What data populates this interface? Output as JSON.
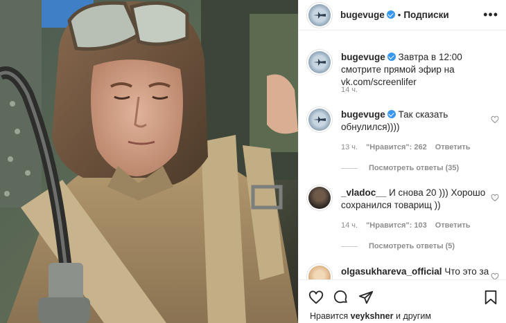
{
  "post": {
    "author": "bugevuge",
    "header_separator": "•",
    "follow_status": "Подписки",
    "more_icon": "more-dots-icon"
  },
  "comments": [
    {
      "user": "bugevuge",
      "text": "Завтра в 12:00 смотрите прямой эфир на vk.com/screenlifer",
      "time": "14 ч.",
      "verified": true
    },
    {
      "user": "bugevuge",
      "text": "Так сказать обнулился))))",
      "time": "13 ч.",
      "likes": "\"Нравится\": 262",
      "reply": "Ответить",
      "replies": "Посмотреть ответы (35)",
      "verified": true
    },
    {
      "user": "_vladoc__",
      "text": "И снова 20 ))) Хорошо сохранился товарищ ))",
      "time": "14 ч.",
      "likes": "\"Нравится\": 103",
      "reply": "Ответить",
      "replies": "Посмотреть ответы (5)"
    },
    {
      "user": "olgasukhareva_official",
      "text": "Что это за"
    }
  ],
  "footer": {
    "liked_prefix": "Нравится",
    "liked_user": "veykshner",
    "liked_suffix": "и другим"
  },
  "colors": {
    "accent_blue": "#3897f0",
    "muted": "#8e8e8e",
    "text": "#262626"
  }
}
